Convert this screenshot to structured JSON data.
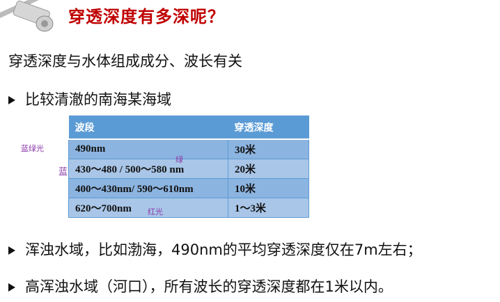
{
  "title": "穿透深度有多深呢？",
  "subtitle": "穿透深度与水体组成成分、波长有关",
  "bullets": [
    "比较清澈的南海某海域",
    "浑浊水域，比如渤海，490nm的平均穿透深度仅在7m左右；",
    "高浑浊水域（河口），所有波长的穿透深度都在1米以内。"
  ],
  "table": {
    "headers": [
      "波段",
      "穿透深度"
    ],
    "rows": [
      [
        "490nm",
        "30米"
      ],
      [
        "430～480 / 500～580 nm",
        "20米"
      ],
      [
        "400～430nm/ 590～610nm",
        "10米"
      ],
      [
        "620～700nm",
        "1～3米"
      ]
    ]
  },
  "annotations": {
    "blue_green": "蓝绿光",
    "blue": "蓝",
    "green": "绿",
    "red": "红光"
  },
  "colors": {
    "title": "#c00000",
    "table_header": "#5b9bd5"
  }
}
